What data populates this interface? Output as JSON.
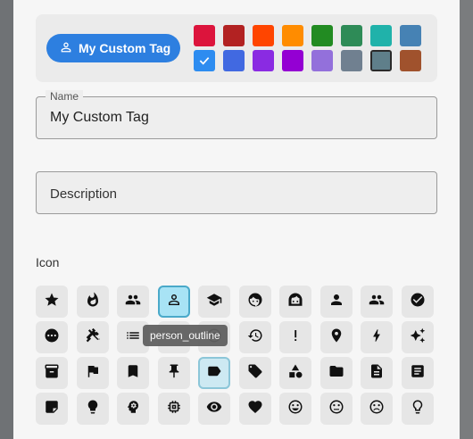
{
  "preview": {
    "tag_label": "My Custom Tag",
    "tag_icon": "person-outline-icon",
    "tag_color": "#2d7fe0"
  },
  "colors": {
    "row1": [
      "#dc143c",
      "#b22222",
      "#ff4500",
      "#ff8c00",
      "#228b22",
      "#2e8b57",
      "#20b2aa",
      "#4682b4"
    ],
    "row2": [
      "#2d8cf0",
      "#4169e1",
      "#8a2be2",
      "#9400d3",
      "#9370db",
      "#708090",
      "#5f7f8a",
      "#a0522d"
    ],
    "selected": "#2d8cf0",
    "outlined": "#5f7f8a"
  },
  "name_field": {
    "label": "Name",
    "value": "My Custom Tag"
  },
  "description_field": {
    "placeholder": "Description"
  },
  "icon_section": {
    "label": "Icon"
  },
  "icons": {
    "row1": [
      "star-icon",
      "fire-icon",
      "people-icon",
      "person-outline-icon",
      "school-icon",
      "emoji-icon",
      "face-icon",
      "person-icon",
      "group-icon",
      "check-circle-icon"
    ],
    "row2": [
      "more-horiz-icon",
      "tools-icon",
      "list-icon",
      "list-icon",
      "target-icon",
      "history-icon",
      "exclamation-icon",
      "location-icon",
      "bolt-icon",
      "sparkle-icon"
    ],
    "row3": [
      "archive-icon",
      "flag-icon",
      "bookmark-icon",
      "pin-icon",
      "label-icon",
      "tag-icon",
      "shapes-icon",
      "folder-icon",
      "document-icon",
      "article-icon"
    ],
    "row4": [
      "sticky-note-icon",
      "lightbulb-icon",
      "psychology-icon",
      "memory-icon",
      "eye-icon",
      "heart-icon",
      "smile-icon",
      "neutral-face-icon",
      "sad-face-icon",
      "bulb-outline-icon"
    ],
    "selected": "person-outline-icon",
    "hovered": "label-icon"
  },
  "tooltip": {
    "text": "person_outline"
  }
}
